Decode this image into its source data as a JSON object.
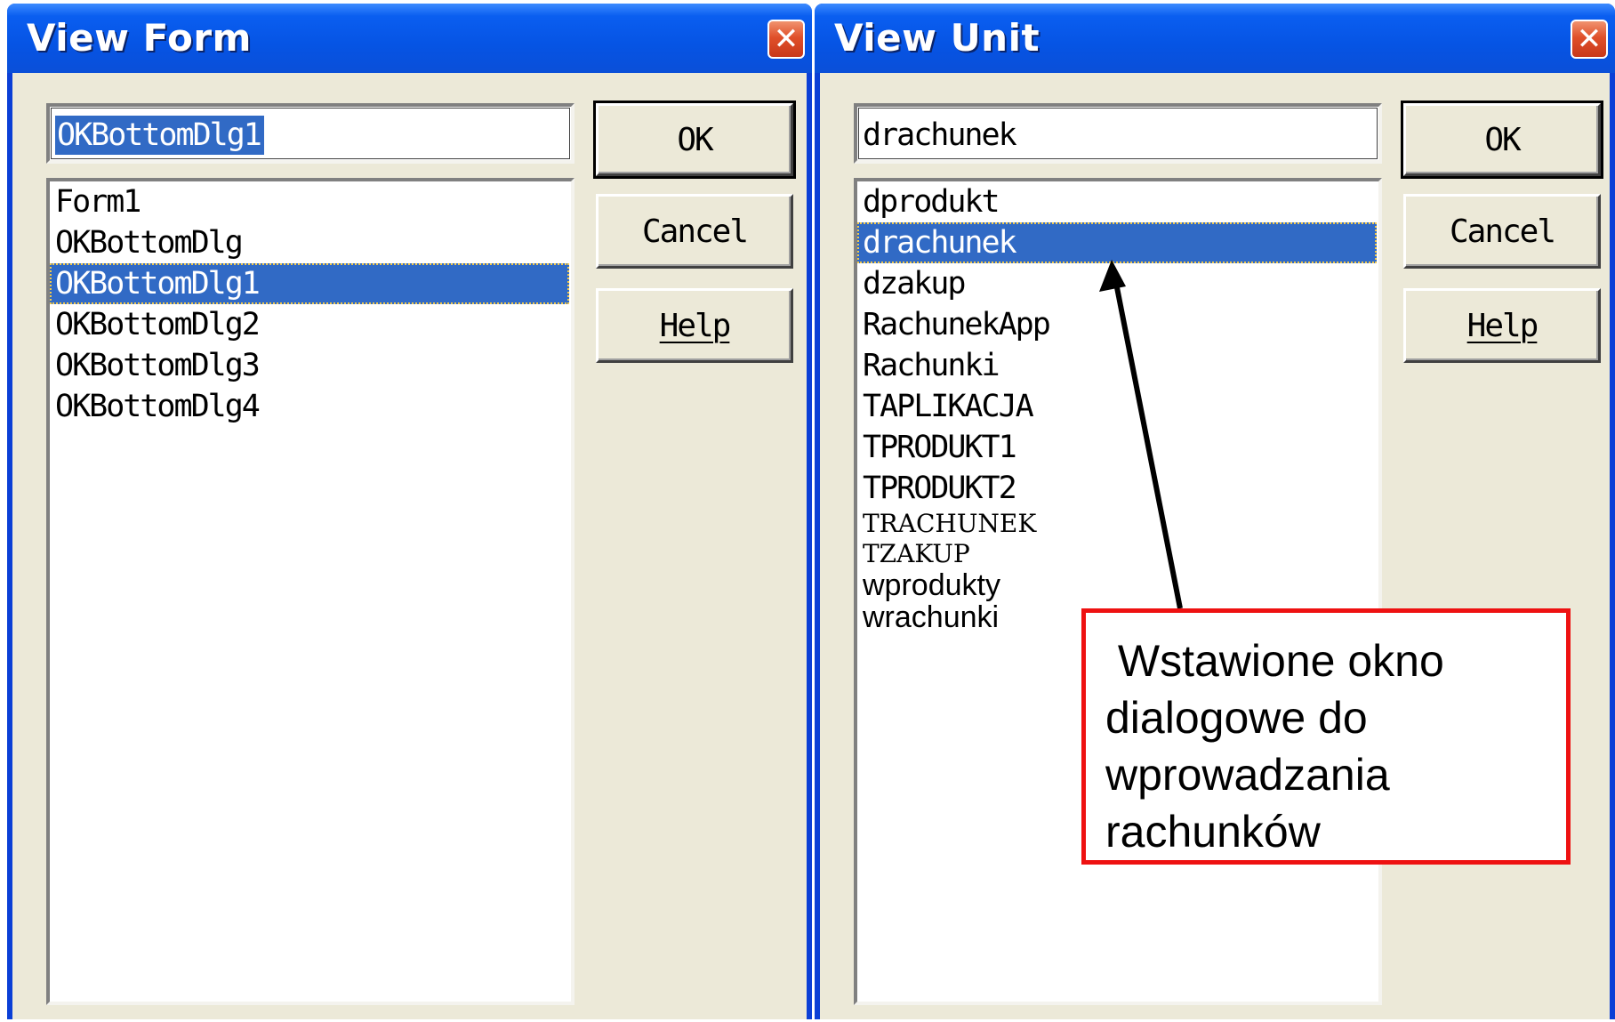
{
  "view_form": {
    "title": "View Form",
    "close_symbol": "✕",
    "edit_value": "OKBottomDlg1",
    "items": [
      "Form1",
      "OKBottomDlg",
      "OKBottomDlg1",
      "OKBottomDlg2",
      "OKBottomDlg3",
      "OKBottomDlg4"
    ],
    "selected_item": "OKBottomDlg1",
    "buttons": {
      "ok": "OK",
      "cancel": "Cancel",
      "help": "Help"
    }
  },
  "view_unit": {
    "title": "View Unit",
    "close_symbol": "✕",
    "edit_value": "drachunek",
    "items": [
      "dprodukt",
      "drachunek",
      "dzakup",
      "RachunekApp",
      "Rachunki",
      "TAPLIKACJA",
      "TPRODUKT1",
      "TPRODUKT2",
      "TRACHUNEK",
      "TZAKUP",
      "wprodukty",
      "wrachunki"
    ],
    "selected_item": "drachunek",
    "buttons": {
      "ok": "OK",
      "cancel": "Cancel",
      "help": "Help"
    }
  },
  "annotation": {
    "text": " Wstawione okno\ndialogowe do\nwprowadzania\nrachunków",
    "border_color": "#ee1111"
  },
  "colors": {
    "titlebar": "#0654e4",
    "client_background": "#ece9d8",
    "selection": "#316ac5",
    "close_button": "#e0502a"
  },
  "icons": {
    "close": "close-icon",
    "arrow": "pointer-arrow-icon"
  }
}
